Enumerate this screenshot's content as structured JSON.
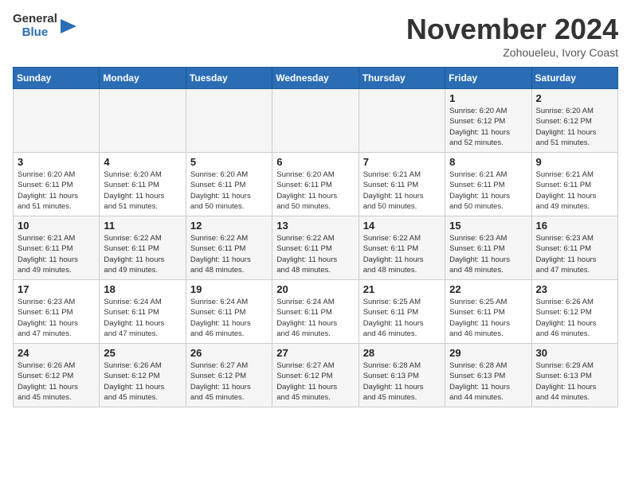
{
  "header": {
    "logo_line1": "General",
    "logo_line2": "Blue",
    "month": "November 2024",
    "location": "Zohoueleu, Ivory Coast"
  },
  "weekdays": [
    "Sunday",
    "Monday",
    "Tuesday",
    "Wednesday",
    "Thursday",
    "Friday",
    "Saturday"
  ],
  "weeks": [
    [
      {
        "day": "",
        "info": ""
      },
      {
        "day": "",
        "info": ""
      },
      {
        "day": "",
        "info": ""
      },
      {
        "day": "",
        "info": ""
      },
      {
        "day": "",
        "info": ""
      },
      {
        "day": "1",
        "info": "Sunrise: 6:20 AM\nSunset: 6:12 PM\nDaylight: 11 hours\nand 52 minutes."
      },
      {
        "day": "2",
        "info": "Sunrise: 6:20 AM\nSunset: 6:12 PM\nDaylight: 11 hours\nand 51 minutes."
      }
    ],
    [
      {
        "day": "3",
        "info": "Sunrise: 6:20 AM\nSunset: 6:11 PM\nDaylight: 11 hours\nand 51 minutes."
      },
      {
        "day": "4",
        "info": "Sunrise: 6:20 AM\nSunset: 6:11 PM\nDaylight: 11 hours\nand 51 minutes."
      },
      {
        "day": "5",
        "info": "Sunrise: 6:20 AM\nSunset: 6:11 PM\nDaylight: 11 hours\nand 50 minutes."
      },
      {
        "day": "6",
        "info": "Sunrise: 6:20 AM\nSunset: 6:11 PM\nDaylight: 11 hours\nand 50 minutes."
      },
      {
        "day": "7",
        "info": "Sunrise: 6:21 AM\nSunset: 6:11 PM\nDaylight: 11 hours\nand 50 minutes."
      },
      {
        "day": "8",
        "info": "Sunrise: 6:21 AM\nSunset: 6:11 PM\nDaylight: 11 hours\nand 50 minutes."
      },
      {
        "day": "9",
        "info": "Sunrise: 6:21 AM\nSunset: 6:11 PM\nDaylight: 11 hours\nand 49 minutes."
      }
    ],
    [
      {
        "day": "10",
        "info": "Sunrise: 6:21 AM\nSunset: 6:11 PM\nDaylight: 11 hours\nand 49 minutes."
      },
      {
        "day": "11",
        "info": "Sunrise: 6:22 AM\nSunset: 6:11 PM\nDaylight: 11 hours\nand 49 minutes."
      },
      {
        "day": "12",
        "info": "Sunrise: 6:22 AM\nSunset: 6:11 PM\nDaylight: 11 hours\nand 48 minutes."
      },
      {
        "day": "13",
        "info": "Sunrise: 6:22 AM\nSunset: 6:11 PM\nDaylight: 11 hours\nand 48 minutes."
      },
      {
        "day": "14",
        "info": "Sunrise: 6:22 AM\nSunset: 6:11 PM\nDaylight: 11 hours\nand 48 minutes."
      },
      {
        "day": "15",
        "info": "Sunrise: 6:23 AM\nSunset: 6:11 PM\nDaylight: 11 hours\nand 48 minutes."
      },
      {
        "day": "16",
        "info": "Sunrise: 6:23 AM\nSunset: 6:11 PM\nDaylight: 11 hours\nand 47 minutes."
      }
    ],
    [
      {
        "day": "17",
        "info": "Sunrise: 6:23 AM\nSunset: 6:11 PM\nDaylight: 11 hours\nand 47 minutes."
      },
      {
        "day": "18",
        "info": "Sunrise: 6:24 AM\nSunset: 6:11 PM\nDaylight: 11 hours\nand 47 minutes."
      },
      {
        "day": "19",
        "info": "Sunrise: 6:24 AM\nSunset: 6:11 PM\nDaylight: 11 hours\nand 46 minutes."
      },
      {
        "day": "20",
        "info": "Sunrise: 6:24 AM\nSunset: 6:11 PM\nDaylight: 11 hours\nand 46 minutes."
      },
      {
        "day": "21",
        "info": "Sunrise: 6:25 AM\nSunset: 6:11 PM\nDaylight: 11 hours\nand 46 minutes."
      },
      {
        "day": "22",
        "info": "Sunrise: 6:25 AM\nSunset: 6:11 PM\nDaylight: 11 hours\nand 46 minutes."
      },
      {
        "day": "23",
        "info": "Sunrise: 6:26 AM\nSunset: 6:12 PM\nDaylight: 11 hours\nand 46 minutes."
      }
    ],
    [
      {
        "day": "24",
        "info": "Sunrise: 6:26 AM\nSunset: 6:12 PM\nDaylight: 11 hours\nand 45 minutes."
      },
      {
        "day": "25",
        "info": "Sunrise: 6:26 AM\nSunset: 6:12 PM\nDaylight: 11 hours\nand 45 minutes."
      },
      {
        "day": "26",
        "info": "Sunrise: 6:27 AM\nSunset: 6:12 PM\nDaylight: 11 hours\nand 45 minutes."
      },
      {
        "day": "27",
        "info": "Sunrise: 6:27 AM\nSunset: 6:12 PM\nDaylight: 11 hours\nand 45 minutes."
      },
      {
        "day": "28",
        "info": "Sunrise: 6:28 AM\nSunset: 6:13 PM\nDaylight: 11 hours\nand 45 minutes."
      },
      {
        "day": "29",
        "info": "Sunrise: 6:28 AM\nSunset: 6:13 PM\nDaylight: 11 hours\nand 44 minutes."
      },
      {
        "day": "30",
        "info": "Sunrise: 6:29 AM\nSunset: 6:13 PM\nDaylight: 11 hours\nand 44 minutes."
      }
    ]
  ]
}
